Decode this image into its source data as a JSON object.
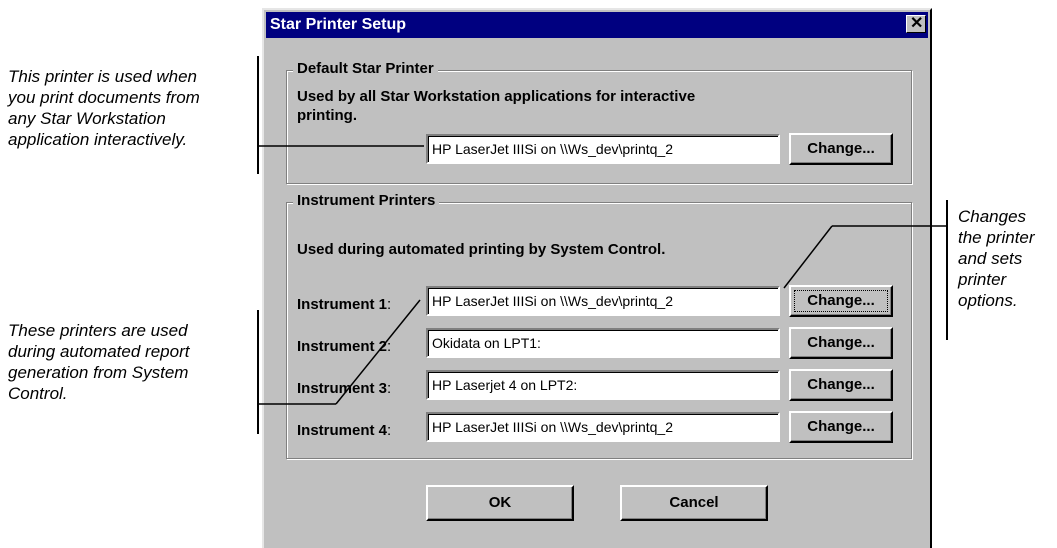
{
  "callouts": {
    "default_printer": [
      "This printer is used when",
      "you print documents from",
      "any Star Workstation",
      "application interactively."
    ],
    "instrument_printers": [
      "These printers are used",
      "during automated report",
      "generation from System",
      "Control."
    ],
    "change_button": [
      "Changes",
      "the printer",
      "and sets",
      "printer",
      "options."
    ]
  },
  "dialog": {
    "title": "Star Printer Setup",
    "close_glyph": "✕",
    "default_group": {
      "label": "Default Star Printer",
      "description_lines": [
        "Used by all Star Workstation applications for interactive",
        "printing."
      ],
      "printer": "HP LaserJet IIISi on \\\\Ws_dev\\printq_2",
      "change_label": "Change..."
    },
    "instrument_group": {
      "label": "Instrument Printers",
      "description": "Used during automated printing by System Control.",
      "instruments": [
        {
          "label": "Instrument 1",
          "printer": "HP LaserJet IIISi on \\\\Ws_dev\\printq_2",
          "change_label": "Change..."
        },
        {
          "label": "Instrument 2",
          "printer": "Okidata on LPT1:",
          "change_label": "Change..."
        },
        {
          "label": "Instrument 3",
          "printer": "HP Laserjet 4 on LPT2:",
          "change_label": "Change..."
        },
        {
          "label": "Instrument 4",
          "printer": "HP LaserJet IIISi on \\\\Ws_dev\\printq_2",
          "change_label": "Change..."
        }
      ]
    },
    "ok_label": "OK",
    "cancel_label": "Cancel"
  }
}
